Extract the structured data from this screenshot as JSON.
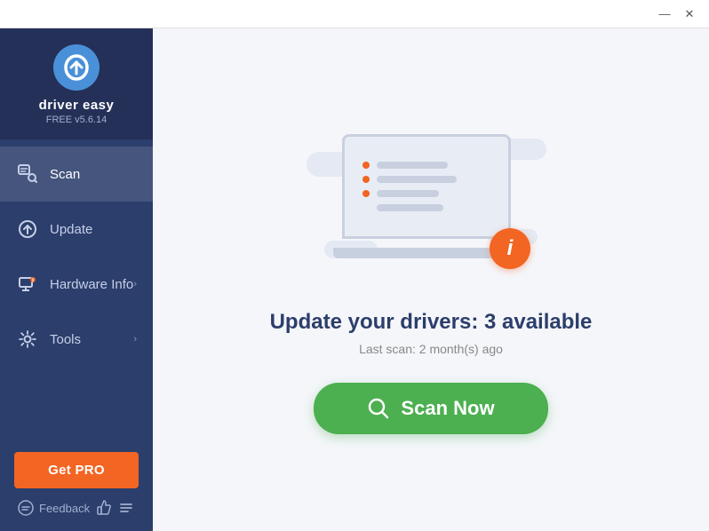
{
  "titlebar": {
    "minimize_label": "—",
    "close_label": "✕"
  },
  "sidebar": {
    "app_name": "driver easy",
    "app_version": "FREE v5.6.14",
    "nav_items": [
      {
        "id": "scan",
        "label": "Scan",
        "has_arrow": false,
        "active": true
      },
      {
        "id": "update",
        "label": "Update",
        "has_arrow": false,
        "active": false
      },
      {
        "id": "hardware-info",
        "label": "Hardware Info",
        "has_arrow": true,
        "active": false
      },
      {
        "id": "tools",
        "label": "Tools",
        "has_arrow": true,
        "active": false
      }
    ],
    "get_pro_label": "Get PRO",
    "feedback_label": "Feedback"
  },
  "main": {
    "title": "Update your drivers: 3 available",
    "subtitle": "Last scan: 2 month(s) ago",
    "scan_button_label": "Scan Now"
  },
  "colors": {
    "sidebar_bg": "#2c3e6b",
    "sidebar_header_bg": "#243058",
    "accent_orange": "#f26522",
    "accent_green": "#4caf50",
    "info_badge": "#f26522"
  }
}
